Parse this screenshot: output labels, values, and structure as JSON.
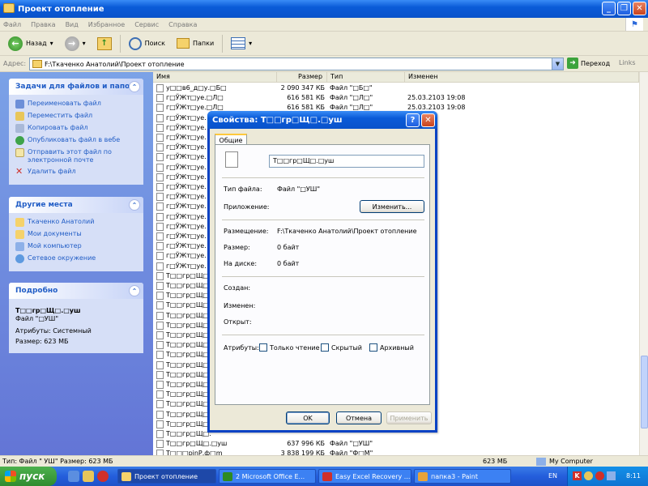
{
  "window": {
    "title": "Проект отопление"
  },
  "menu": [
    "Файл",
    "Правка",
    "Вид",
    "Избранное",
    "Сервис",
    "Справка"
  ],
  "toolbar": {
    "back": "Назад",
    "search": "Поиск",
    "folders": "Папки"
  },
  "address": {
    "label": "Адрес:",
    "value": "F:\\Ткаченко Анатолий\\Проект отопление",
    "go": "Переход",
    "links": "Links"
  },
  "tasks_panel": {
    "title": "Задачи для файлов и папок",
    "items": [
      "Переименовать файл",
      "Переместить файл",
      "Копировать файл",
      "Опубликовать файл в вебе",
      "Отправить этот файл по электронной почте",
      "Удалить файл"
    ]
  },
  "places_panel": {
    "title": "Другие места",
    "items": [
      "Ткаченко Анатолий",
      "Мои документы",
      "Мой компьютер",
      "Сетевое окружение"
    ]
  },
  "details_panel": {
    "title": "Подробно",
    "name": "Т□□гр□Щ□.□уш",
    "type": "Файл \"□УШ\"",
    "attributes": "Атрибуты: Системный",
    "size": "Размер: 623 МБ"
  },
  "columns": {
    "name": "Имя",
    "size": "Размер",
    "type": "Тип",
    "modified": "Изменен"
  },
  "files": [
    {
      "name": "у□□в6_д□у.□Б□",
      "size": "2 090 347 КБ",
      "type": "Файл \"□Б□\"",
      "date": ""
    },
    {
      "name": "г□ЎЖт□уе.□Л□",
      "size": "616 581 КБ",
      "type": "Файл \"□Л□\"",
      "date": "25.03.2103 19:08"
    },
    {
      "name": "г□ЎЖт□уе.□Л□",
      "size": "616 581 КБ",
      "type": "Файл \"□Л□\"",
      "date": "25.03.2103 19:08"
    },
    {
      "name": "г□ЎЖт□уе.",
      "size": "",
      "type": "",
      "date": "3 19:08"
    },
    {
      "name": "г□ЎЖт□уе.",
      "size": "",
      "type": "",
      "date": "3 19:08"
    },
    {
      "name": "г□ЎЖт□уе.",
      "size": "",
      "type": "",
      "date": "3 19:08"
    },
    {
      "name": "г□ЎЖт□уе.",
      "size": "",
      "type": "",
      "date": "3 19:08"
    },
    {
      "name": "г□ЎЖт□уе.",
      "size": "",
      "type": "",
      "date": "3 19:08"
    },
    {
      "name": "г□ЎЖт□уе.",
      "size": "",
      "type": "",
      "date": "3 19:08"
    },
    {
      "name": "г□ЎЖт□уе.",
      "size": "",
      "type": "",
      "date": "3 19:08"
    },
    {
      "name": "г□ЎЖт□уе.",
      "size": "",
      "type": "",
      "date": "3 19:08"
    },
    {
      "name": "г□ЎЖт□уе.",
      "size": "",
      "type": "",
      "date": "3 19:08"
    },
    {
      "name": "г□ЎЖт□уе.",
      "size": "",
      "type": "",
      "date": "3 19:08"
    },
    {
      "name": "г□ЎЖт□уе.",
      "size": "",
      "type": "",
      "date": "3 19:08"
    },
    {
      "name": "г□ЎЖт□уе.",
      "size": "",
      "type": "",
      "date": "3 19:08"
    },
    {
      "name": "г□ЎЖт□уе.",
      "size": "",
      "type": "",
      "date": "3 19:08"
    },
    {
      "name": "г□ЎЖт□уе.",
      "size": "",
      "type": "",
      "date": "3 19:08"
    },
    {
      "name": "г□ЎЖт□уе.",
      "size": "",
      "type": "",
      "date": "3 19:08"
    },
    {
      "name": "г□ЎЖт□уе.",
      "size": "",
      "type": "",
      "date": "3 19:08"
    },
    {
      "name": "Т□□гр□Щ□.",
      "size": "",
      "type": "",
      "date": ""
    },
    {
      "name": "Т□□гр□Щ□.",
      "size": "",
      "type": "",
      "date": ""
    },
    {
      "name": "Т□□гр□Щ□.",
      "size": "",
      "type": "",
      "date": ""
    },
    {
      "name": "Т□□гр□Щ□.",
      "size": "",
      "type": "",
      "date": ""
    },
    {
      "name": "Т□□гр□Щ□.",
      "size": "",
      "type": "",
      "date": ""
    },
    {
      "name": "Т□□гр□Щ□.",
      "size": "",
      "type": "",
      "date": ""
    },
    {
      "name": "Т□□гр□Щ□.",
      "size": "",
      "type": "",
      "date": ""
    },
    {
      "name": "Т□□гр□Щ□.",
      "size": "",
      "type": "",
      "date": ""
    },
    {
      "name": "Т□□гр□Щ□.",
      "size": "",
      "type": "",
      "date": ""
    },
    {
      "name": "Т□□гр□Щ□.",
      "size": "",
      "type": "",
      "date": ""
    },
    {
      "name": "Т□□гр□Щ□.",
      "size": "",
      "type": "",
      "date": ""
    },
    {
      "name": "Т□□гр□Щ□.",
      "size": "",
      "type": "",
      "date": ""
    },
    {
      "name": "Т□□гр□Щ□.",
      "size": "",
      "type": "",
      "date": ""
    },
    {
      "name": "Т□□гр□Щ□.",
      "size": "",
      "type": "",
      "date": ""
    },
    {
      "name": "Т□□гр□Щ□.",
      "size": "",
      "type": "",
      "date": ""
    },
    {
      "name": "Т□□гр□Щ□.",
      "size": "",
      "type": "",
      "date": ""
    },
    {
      "name": "Т□□гр□Щ□.",
      "size": "",
      "type": "",
      "date": ""
    },
    {
      "name": "Т□□гр□Щ□.□уш",
      "size": "637 996 КБ",
      "type": "Файл \"□УШ\"",
      "date": ""
    },
    {
      "name": "Т□□□pinР.ф□m",
      "size": "3 838 199 КБ",
      "type": "Файл \"Ф□М\"",
      "date": ""
    }
  ],
  "dialog": {
    "title": "Свойства: Т□□гр□Щ□.□уш",
    "tab": "Общие",
    "filename": "Т□□гр□Щ□.□уш",
    "type_label": "Тип файла:",
    "type_value": "Файл \"□УШ\"",
    "app_label": "Приложение:",
    "change": "Изменить...",
    "location_label": "Размещение:",
    "location_value": "F:\\Ткаченко Анатолий\\Проект отопление",
    "size_label": "Размер:",
    "size_value": "0 байт",
    "disk_label": "На диске:",
    "disk_value": "0 байт",
    "created_label": "Создан:",
    "modified_label": "Изменен:",
    "opened_label": "Открыт:",
    "attrs_label": "Атрибуты:",
    "readonly": "Только чтение",
    "hidden": "Скрытый",
    "archive": "Архивный",
    "ok": "OK",
    "cancel": "Отмена",
    "apply": "Применить"
  },
  "status": {
    "left": "Тип: Файл \" УШ\" Размер: 623 МБ",
    "size": "623 МБ",
    "location": "My Computer"
  },
  "taskbar": {
    "start": "пуск",
    "tasks": [
      "Проект отопление",
      "2 Microsoft Office E...",
      "Easy Excel Recovery ...",
      "папка3 - Paint"
    ],
    "lang": "EN",
    "clock": "8:11"
  }
}
